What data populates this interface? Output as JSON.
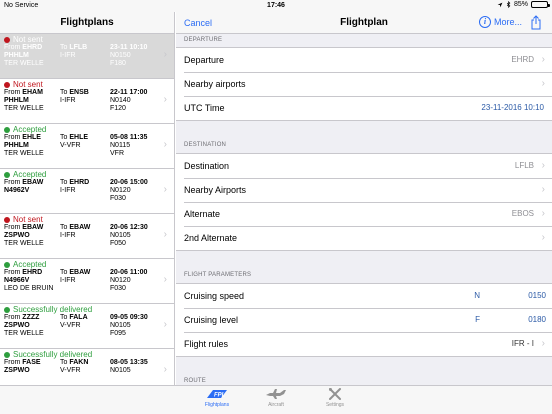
{
  "statusbar": {
    "carrier": "No Service",
    "time": "17:46",
    "battery": "85%",
    "battery_level": 0.85
  },
  "left": {
    "title": "Flightplans",
    "items": [
      {
        "status": "Not sent",
        "status_color": "#c0161e",
        "from_label": "From",
        "from": "EHRD",
        "to_label": "To",
        "to": "LFLB",
        "date": "23-11 10:10",
        "reg": "PHHLM",
        "rules": "I-IFR",
        "speed": "N0150",
        "pilot": "TER WELLE",
        "level": "F180",
        "selected": true
      },
      {
        "status": "Not sent",
        "status_color": "#c0161e",
        "from_label": "From",
        "from": "EHAM",
        "to_label": "To",
        "to": "ENSB",
        "date": "22-11 17:00",
        "reg": "PHHLM",
        "rules": "I-IFR",
        "speed": "N0140",
        "pilot": "TER WELLE",
        "level": "F120"
      },
      {
        "status": "Accepted",
        "status_color": "#2e9e3e",
        "from_label": "From",
        "from": "EHLE",
        "to_label": "To",
        "to": "EHLE",
        "date": "05-08 11:35",
        "reg": "PHHLM",
        "rules": "V-VFR",
        "speed": "N0115",
        "pilot": "TER WELLE",
        "level": "VFR"
      },
      {
        "status": "Accepted",
        "status_color": "#2e9e3e",
        "from_label": "From",
        "from": "EBAW",
        "to_label": "To",
        "to": "EHRD",
        "date": "20-06 15:00",
        "reg": "N4962V",
        "rules": "I-IFR",
        "speed": "N0120",
        "pilot": "",
        "level": "F030"
      },
      {
        "status": "Not sent",
        "status_color": "#c0161e",
        "from_label": "From",
        "from": "EBAW",
        "to_label": "To",
        "to": "EBAW",
        "date": "20-06 12:30",
        "reg": "ZSPWO",
        "rules": "I-IFR",
        "speed": "N0105",
        "pilot": "TER WELLE",
        "level": "F050"
      },
      {
        "status": "Accepted",
        "status_color": "#2e9e3e",
        "from_label": "From",
        "from": "EHRD",
        "to_label": "To",
        "to": "EBAW",
        "date": "20-06 11:00",
        "reg": "N4966V",
        "rules": "I-IFR",
        "speed": "N0120",
        "pilot": "LEO DE BRUIN",
        "level": "F030"
      },
      {
        "status": "Successfully delivered",
        "status_color": "#2e9e3e",
        "from_label": "From",
        "from": "ZZZZ",
        "to_label": "To",
        "to": "FALA",
        "date": "09-05 09:30",
        "reg": "ZSPWO",
        "rules": "V-VFR",
        "speed": "N0105",
        "pilot": "TER WELLE",
        "level": "F095"
      },
      {
        "status": "Successfully delivered",
        "status_color": "#2e9e3e",
        "from_label": "From",
        "from": "FASE",
        "to_label": "To",
        "to": "FAKN",
        "date": "08-05 13:35",
        "reg": "ZSPWO",
        "rules": "V-VFR",
        "speed": "N0105",
        "pilot": "",
        "level": ""
      }
    ]
  },
  "right": {
    "cancel": "Cancel",
    "title": "Flightplan",
    "more": "More...",
    "departure": {
      "header": "DEPARTURE",
      "departure_label": "Departure",
      "departure_value": "EHRD",
      "nearby_label": "Nearby airports",
      "utc_label": "UTC Time",
      "utc_value": "23-11-2016 10:10"
    },
    "destination": {
      "header": "DESTINATION",
      "destination_label": "Destination",
      "destination_value": "LFLB",
      "nearby_label": "Nearby Airports",
      "alternate_label": "Alternate",
      "alternate_value": "EBOS",
      "alternate2_label": "2nd Alternate"
    },
    "params": {
      "header": "FLIGHT PARAMETERS",
      "speed_label": "Cruising speed",
      "speed_unit": "N",
      "speed_value": "0150",
      "level_label": "Cruising level",
      "level_unit": "F",
      "level_value": "0180",
      "rules_label": "Flight rules",
      "rules_value": "IFR - I"
    },
    "route": {
      "header": "ROUTE"
    }
  },
  "tabbar": {
    "flightplans": "Flightplans",
    "aircraft": "Aircraft",
    "settings": "Settings",
    "logo": "FPL"
  },
  "colors": {
    "accent": "#2b6cf4",
    "value_blue": "#2b5aa6",
    "red": "#c0161e",
    "green": "#2e9e3e"
  }
}
